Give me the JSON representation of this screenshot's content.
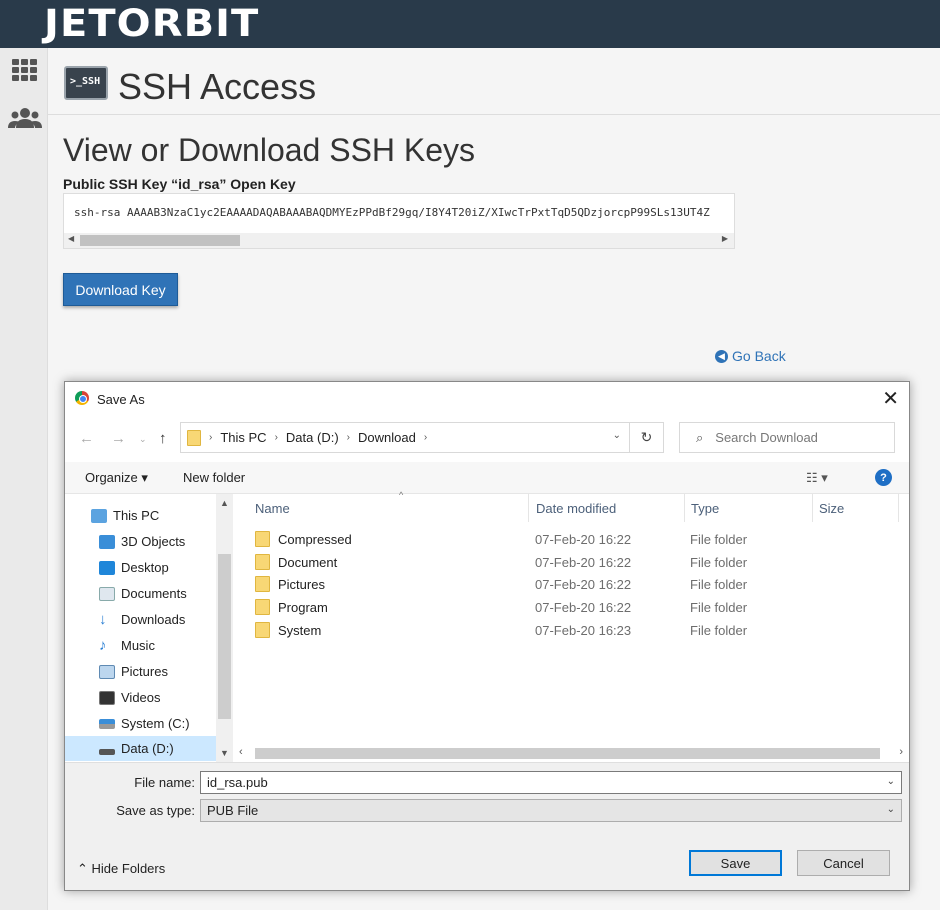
{
  "brand": {
    "logo_text": "JETORBIT",
    "topbar_color": "#293a4a"
  },
  "sidebar": {
    "icons": [
      "grid-icon",
      "users-icon"
    ]
  },
  "header": {
    "icon_text": ">_SSH",
    "title": "SSH Access"
  },
  "section": {
    "title": "View or Download SSH Keys",
    "key_label": "Public SSH Key “id_rsa” Open Key",
    "key_text": "ssh-rsa AAAAB3NzaC1yc2EAAAADAQABAAABAQDMYEzPPdBf29gq/I8Y4T20iZ/XIwcTrPxtTqD5QDzjorcpP99SLs13UT4Z",
    "download_button": "Download Key",
    "go_back": "Go Back",
    "accent": "#2f73b7"
  },
  "dialog": {
    "title": "Save As",
    "breadcrumb": [
      "This PC",
      "Data (D:)",
      "Download"
    ],
    "search_placeholder": "Search Download",
    "toolbar": {
      "organize": "Organize ▾",
      "new_folder": "New folder"
    },
    "nav_items": [
      {
        "label": "This PC",
        "icon": "computer-icon"
      },
      {
        "label": "3D Objects",
        "icon": "cube-icon"
      },
      {
        "label": "Desktop",
        "icon": "desktop-icon"
      },
      {
        "label": "Documents",
        "icon": "documents-icon"
      },
      {
        "label": "Downloads",
        "icon": "download-arrow-icon"
      },
      {
        "label": "Music",
        "icon": "music-note-icon"
      },
      {
        "label": "Pictures",
        "icon": "pictures-icon"
      },
      {
        "label": "Videos",
        "icon": "film-icon"
      },
      {
        "label": "System (C:)",
        "icon": "drive-icon"
      },
      {
        "label": "Data (D:)",
        "icon": "drive-icon"
      }
    ],
    "columns": [
      "Name",
      "Date modified",
      "Type",
      "Size"
    ],
    "files": [
      {
        "name": "Compressed",
        "date": "07-Feb-20 16:22",
        "type": "File folder"
      },
      {
        "name": "Document",
        "date": "07-Feb-20 16:22",
        "type": "File folder"
      },
      {
        "name": "Pictures",
        "date": "07-Feb-20 16:22",
        "type": "File folder"
      },
      {
        "name": "Program",
        "date": "07-Feb-20 16:22",
        "type": "File folder"
      },
      {
        "name": "System",
        "date": "07-Feb-20 16:23",
        "type": "File folder"
      }
    ],
    "file_name_label": "File name:",
    "file_name_value": "id_rsa.pub",
    "save_type_label": "Save as type:",
    "save_type_value": "PUB File",
    "hide_folders": "Hide Folders",
    "save_button": "Save",
    "cancel_button": "Cancel"
  }
}
